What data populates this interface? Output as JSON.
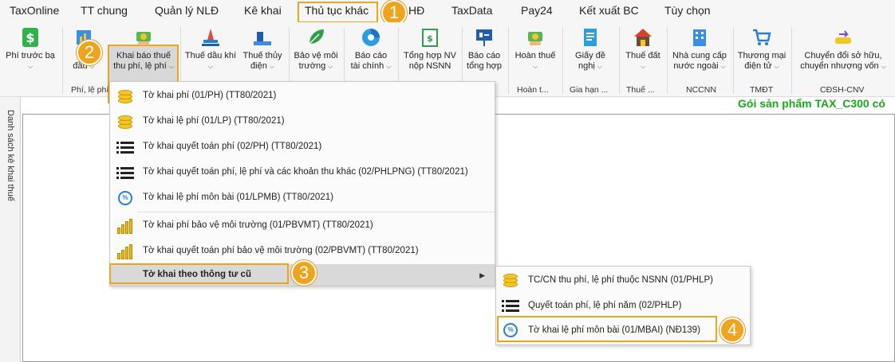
{
  "tabs": [
    "TaxOnline",
    "TT chung",
    "Quản lý NLĐ",
    "Kê khai",
    "Thủ tục khác",
    "HĐ",
    "TaxData",
    "Pay24",
    "Kết xuất BC",
    "Tùy chọn"
  ],
  "badges": [
    "1",
    "2",
    "3",
    "4"
  ],
  "ribbon": {
    "buttons": [
      {
        "line1": "Phí trước bạ",
        "line2": "",
        "icon": "dollar-icon"
      },
      {
        "line1": "Phí",
        "line2": "đầu",
        "icon": "chart-icon"
      },
      {
        "line1": "Khai báo thuế",
        "line2": "thu phí, lệ phí",
        "icon": "money-hand-icon"
      },
      {
        "line1": "Thuế dầu khí",
        "line2": "",
        "icon": "oil-rig-icon"
      },
      {
        "line1": "Thuế thủy",
        "line2": "điện",
        "icon": "dam-icon"
      },
      {
        "line1": "Bảo vệ môi",
        "line2": "trường",
        "icon": "leaf-icon"
      },
      {
        "line1": "Báo cáo",
        "line2": "tài chính",
        "icon": "pie-chart-icon"
      },
      {
        "line1": "Tổng hợp NV",
        "line2": "nộp NSNN",
        "icon": "invoice-icon"
      },
      {
        "line1": "Báo cáo",
        "line2": "tổng hợp",
        "icon": "presentation-icon"
      },
      {
        "line1": "Hoàn thuế",
        "line2": "",
        "icon": "refund-icon"
      },
      {
        "line1": "Giấy đề",
        "line2": "nghị",
        "icon": "document-icon"
      },
      {
        "line1": "Thuế đất",
        "line2": "",
        "icon": "house-icon"
      },
      {
        "line1": "Nhà cung cấp",
        "line2": "nước ngoài",
        "icon": "building-icon"
      },
      {
        "line1": "Thương mại",
        "line2": "điện tử",
        "icon": "cart-icon"
      },
      {
        "line1": "Chuyển đổi sở hữu,",
        "line2": "chuyển nhượng vốn",
        "icon": "transfer-icon"
      }
    ],
    "groups": [
      "Phí, lệ phí",
      "Hoàn t...",
      "Gia hạn ...",
      "Thuế ...",
      "NCCNN",
      "TMĐT",
      "CĐSH-CNV"
    ]
  },
  "promo": "Gói sản phẩm TAX_C300 có",
  "side_panel_label": "Danh sách kê khai thuế",
  "menu": {
    "items": [
      {
        "label": "Tờ khai phí (01/PH) (TT80/2021)",
        "icon": "coins-icon"
      },
      {
        "label": "Tờ khai lệ phí (01/LP) (TT80/2021)",
        "icon": "coins-icon"
      },
      {
        "label": "Tờ khai quyết toán phí (02/PH) (TT80/2021)",
        "icon": "list-icon"
      },
      {
        "label": "Tờ khai quyết toán phí, lệ phí và các khoản thu khác (02/PHLPNG) (TT80/2021)",
        "icon": "list-icon"
      },
      {
        "label": "Tờ khai lệ phí môn bài (01/LPMB) (TT80/2021)",
        "icon": "percent-refresh-icon"
      },
      {
        "label": "Tờ khai phí bảo vệ môi trường (01/PBVMT) (TT80/2021)",
        "icon": "coin-stacks-icon"
      },
      {
        "label": "Tờ khai quyết toán phí bảo vệ môi trường (02/PBVMT) (TT80/2021)",
        "icon": "coin-stacks-icon"
      }
    ],
    "old_forms_label": "Tờ khai theo thông tư cũ"
  },
  "submenu": {
    "items": [
      {
        "label": "TC/CN thu phí, lệ phí thuộc NSNN (01/PHLP)",
        "icon": "coins-icon"
      },
      {
        "label": "Quyết toán phí, lệ phí năm (02/PHLP)",
        "icon": "list-icon"
      },
      {
        "label": "Tờ khai lệ phí môn bài (01/MBAI) (NĐ139)",
        "icon": "percent-refresh-icon"
      }
    ]
  },
  "colors": {
    "highlight": "#f0a31c",
    "promo": "#18a81a",
    "icon_blue": "#2a7fd4",
    "coin": "#f3c623"
  }
}
